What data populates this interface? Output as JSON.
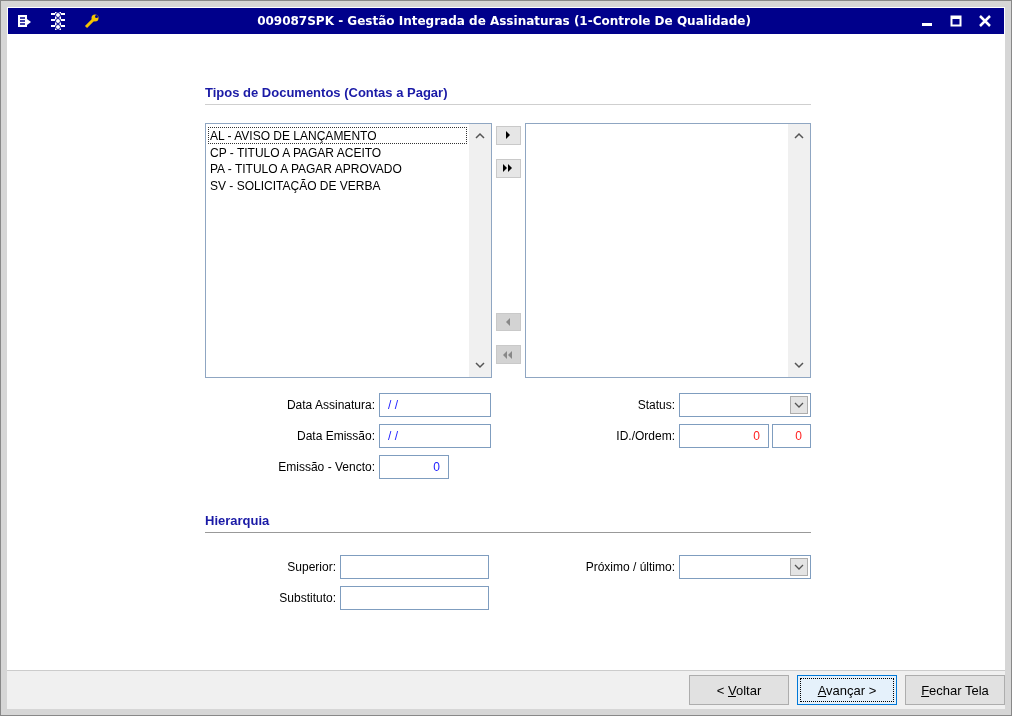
{
  "window": {
    "title": "009087SPK - Gestão Integrada de Assinaturas (1-Controle De Qualidade)"
  },
  "documents": {
    "heading": "Tipos de Documentos (Contas a Pagar)",
    "available": [
      {
        "label": "AL - AVISO DE LANÇAMENTO",
        "selected": true
      },
      {
        "label": "CP - TITULO A PAGAR ACEITO",
        "selected": false
      },
      {
        "label": "PA - TITULO A PAGAR APROVADO",
        "selected": false
      },
      {
        "label": "SV - SOLICITAÇÃO DE VERBA",
        "selected": false
      }
    ],
    "move_buttons": [
      {
        "kind": "one",
        "disabled": false
      },
      {
        "kind": "all",
        "disabled": false
      },
      {
        "kind": "back-one",
        "disabled": true
      },
      {
        "kind": "back-all",
        "disabled": true
      }
    ]
  },
  "filters": {
    "left": [
      {
        "label": "Data Assinatura:",
        "kind": "date",
        "value": "/ /"
      },
      {
        "label": "Data Emissão:",
        "kind": "date",
        "value": "/ /"
      },
      {
        "label": "Emissão - Vencto:",
        "kind": "number",
        "value": "0"
      }
    ],
    "right": [
      {
        "label": "Status:",
        "kind": "dropdown"
      },
      {
        "label": "ID./Ordem:",
        "kind": "pair",
        "values": [
          "0",
          "0"
        ]
      }
    ]
  },
  "hierarchy": {
    "heading": "Hierarquia",
    "left": [
      {
        "label": "Superior:",
        "kind": "text"
      },
      {
        "label": "Substituto:",
        "kind": "text"
      }
    ],
    "right": [
      {
        "label": "Próximo / último:",
        "kind": "dropdown"
      }
    ]
  },
  "buttons": [
    {
      "before": "< ",
      "key": "V",
      "after": "oltar",
      "default": false
    },
    {
      "key": "A",
      "after": "vançar >",
      "default": true
    },
    {
      "key": "F",
      "after": "echar Tela",
      "default": false
    }
  ]
}
